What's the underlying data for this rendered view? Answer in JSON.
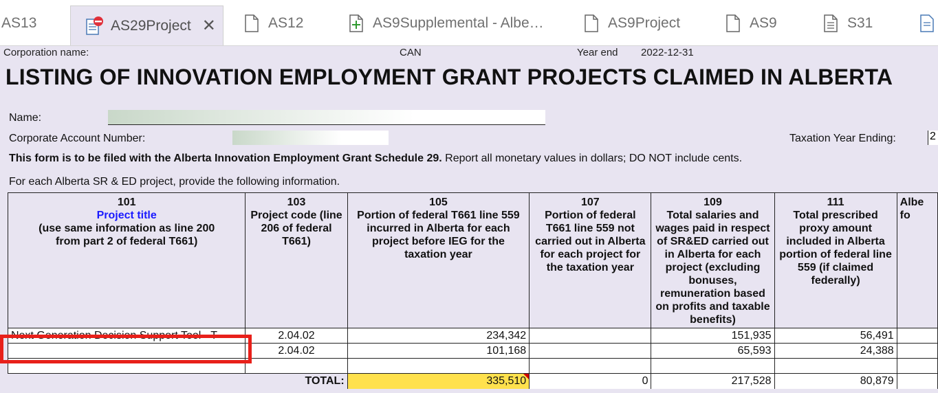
{
  "tabs": [
    {
      "label": "AS13",
      "icon": "none"
    },
    {
      "label": "AS29Project",
      "icon": "doc-error-icon",
      "active": true
    },
    {
      "label": "AS12",
      "icon": "doc-icon"
    },
    {
      "label": "AS9Supplemental - Albe…",
      "icon": "doc-plus-icon"
    },
    {
      "label": "AS9Project",
      "icon": "doc-icon"
    },
    {
      "label": "AS9",
      "icon": "doc-icon"
    },
    {
      "label": "S31",
      "icon": "doc-lines-icon"
    }
  ],
  "close_glyph": "✕",
  "header": {
    "corp_label": "Corporation name:",
    "country": "CAN",
    "year_end_label": "Year end",
    "year_end_value": "2022-12-31",
    "title": "LISTING OF INNOVATION EMPLOYMENT GRANT PROJECTS CLAIMED IN ALBERTA"
  },
  "fields": {
    "name_label": "Name:",
    "can_label": "Corporate Account Number:",
    "tye_label": "Taxation Year Ending:",
    "tye_value": "2"
  },
  "instructions": {
    "bold": "This form is to be filed with the Alberta Innovation Employment Grant Schedule 29.",
    "normal": " Report all monetary values in dollars; DO NOT include cents.",
    "provide": "For each Alberta SR & ED project, provide the following information."
  },
  "table": {
    "columns": [
      {
        "num": "101",
        "title": "Project title",
        "desc": "(use same information as line 200 from part 2 of federal T661)"
      },
      {
        "num": "103",
        "desc": "Project code (line 206 of federal T661)"
      },
      {
        "num": "105",
        "desc": "Portion of federal T661 line 559 incurred in Alberta for each project before IEG for the taxation year"
      },
      {
        "num": "107",
        "desc": "Portion of federal T661 line 559 not carried out in Alberta for each project for the taxation year"
      },
      {
        "num": "109",
        "desc": "Total salaries and wages paid in respect of SR&ED carried out in Alberta for each project (excluding bonuses, remuneration based on profits and taxable benefits)"
      },
      {
        "num": "111",
        "desc": "Total prescribed proxy amount included in Alberta portion of federal line 559 (if claimed federally)"
      },
      {
        "num": "",
        "desc": "Albe fo"
      }
    ],
    "rows": [
      [
        "Next Generation Decision Support Tool - T",
        "2.04.02",
        "234,342",
        "",
        "151,935",
        "56,491",
        ""
      ],
      [
        "",
        "2.04.02",
        "101,168",
        "",
        "65,593",
        "24,388",
        ""
      ],
      [
        "",
        "",
        "",
        "",
        "",
        "",
        ""
      ]
    ],
    "total_label": "TOTAL:",
    "totals": [
      "335,510",
      "0",
      "217,528",
      "80,879",
      ""
    ]
  },
  "colors": {
    "form_bg": "#e8e4f1",
    "highlight": "#e8201a",
    "total_highlight": "#ffe14d",
    "link_blue": "#1a1aff"
  }
}
